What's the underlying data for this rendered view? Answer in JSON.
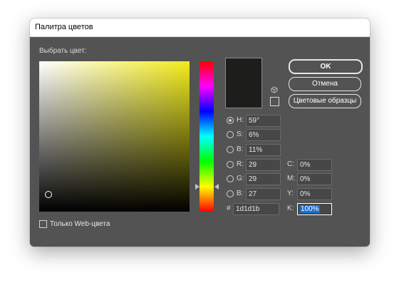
{
  "window": {
    "title": "Палитра цветов"
  },
  "picker": {
    "label": "Выбрать цвет:",
    "color_hex_css": "#1d1d1b",
    "hue_base_css": "#f3ec1a"
  },
  "buttons": {
    "ok": "OK",
    "cancel": "Отмена",
    "swatches": "Цветовые образцы"
  },
  "hsb": {
    "h": {
      "label": "H:",
      "value": "59°",
      "selected": true
    },
    "s": {
      "label": "S:",
      "value": "6%"
    },
    "b": {
      "label": "B:",
      "value": "11%"
    }
  },
  "rgb": {
    "r": {
      "label": "R:",
      "value": "29"
    },
    "g": {
      "label": "G:",
      "value": "29"
    },
    "b": {
      "label": "B:",
      "value": "27"
    }
  },
  "hex": {
    "label": "#",
    "value": "1d1d1b"
  },
  "cmyk": {
    "c": {
      "label": "C:",
      "value": "0%"
    },
    "m": {
      "label": "M:",
      "value": "0%"
    },
    "y": {
      "label": "Y:",
      "value": "0%"
    },
    "k": {
      "label": "K:",
      "value": "100%"
    }
  },
  "web_only": {
    "label": "Только Web-цвета",
    "checked": false
  },
  "icons": {
    "gamut": "cube-icon",
    "swatch": "web-safe-swatch-icon"
  }
}
